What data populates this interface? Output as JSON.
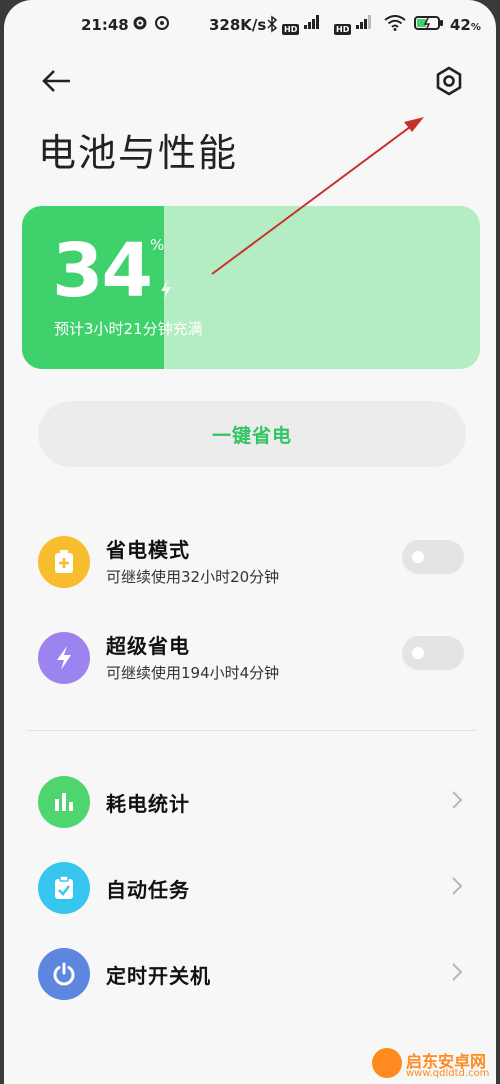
{
  "status_bar": {
    "time": "21:48",
    "network_speed": "328K/s",
    "hd1": "HD",
    "hd2": "HD",
    "battery_percent": "42",
    "battery_unit": "%"
  },
  "header": {
    "title": "电池与性能"
  },
  "battery": {
    "level": "34",
    "unit": "%",
    "fill_fraction": 0.34,
    "estimate": "预计3小时21分钟充满",
    "colors": {
      "fill": "#3fd16c",
      "track": "#b4ecc4"
    }
  },
  "save_button": {
    "label": "一键省电"
  },
  "modes": [
    {
      "title": "省电模式",
      "subtitle": "可继续使用32小时20分钟",
      "icon": "battery-plus-icon",
      "color": "#f7bd2f",
      "enabled": false
    },
    {
      "title": "超级省电",
      "subtitle": "可继续使用194小时4分钟",
      "icon": "lightning-icon",
      "color": "#9b83f0",
      "enabled": false
    }
  ],
  "menu": [
    {
      "title": "耗电统计",
      "icon": "bar-chart-icon",
      "color": "#4fd56f"
    },
    {
      "title": "自动任务",
      "icon": "clipboard-check-icon",
      "color": "#36c6ef"
    },
    {
      "title": "定时开关机",
      "icon": "power-icon",
      "color": "#5f86de"
    }
  ],
  "watermark": {
    "name": "启东安卓网",
    "url": "www.qdldtd.com"
  }
}
